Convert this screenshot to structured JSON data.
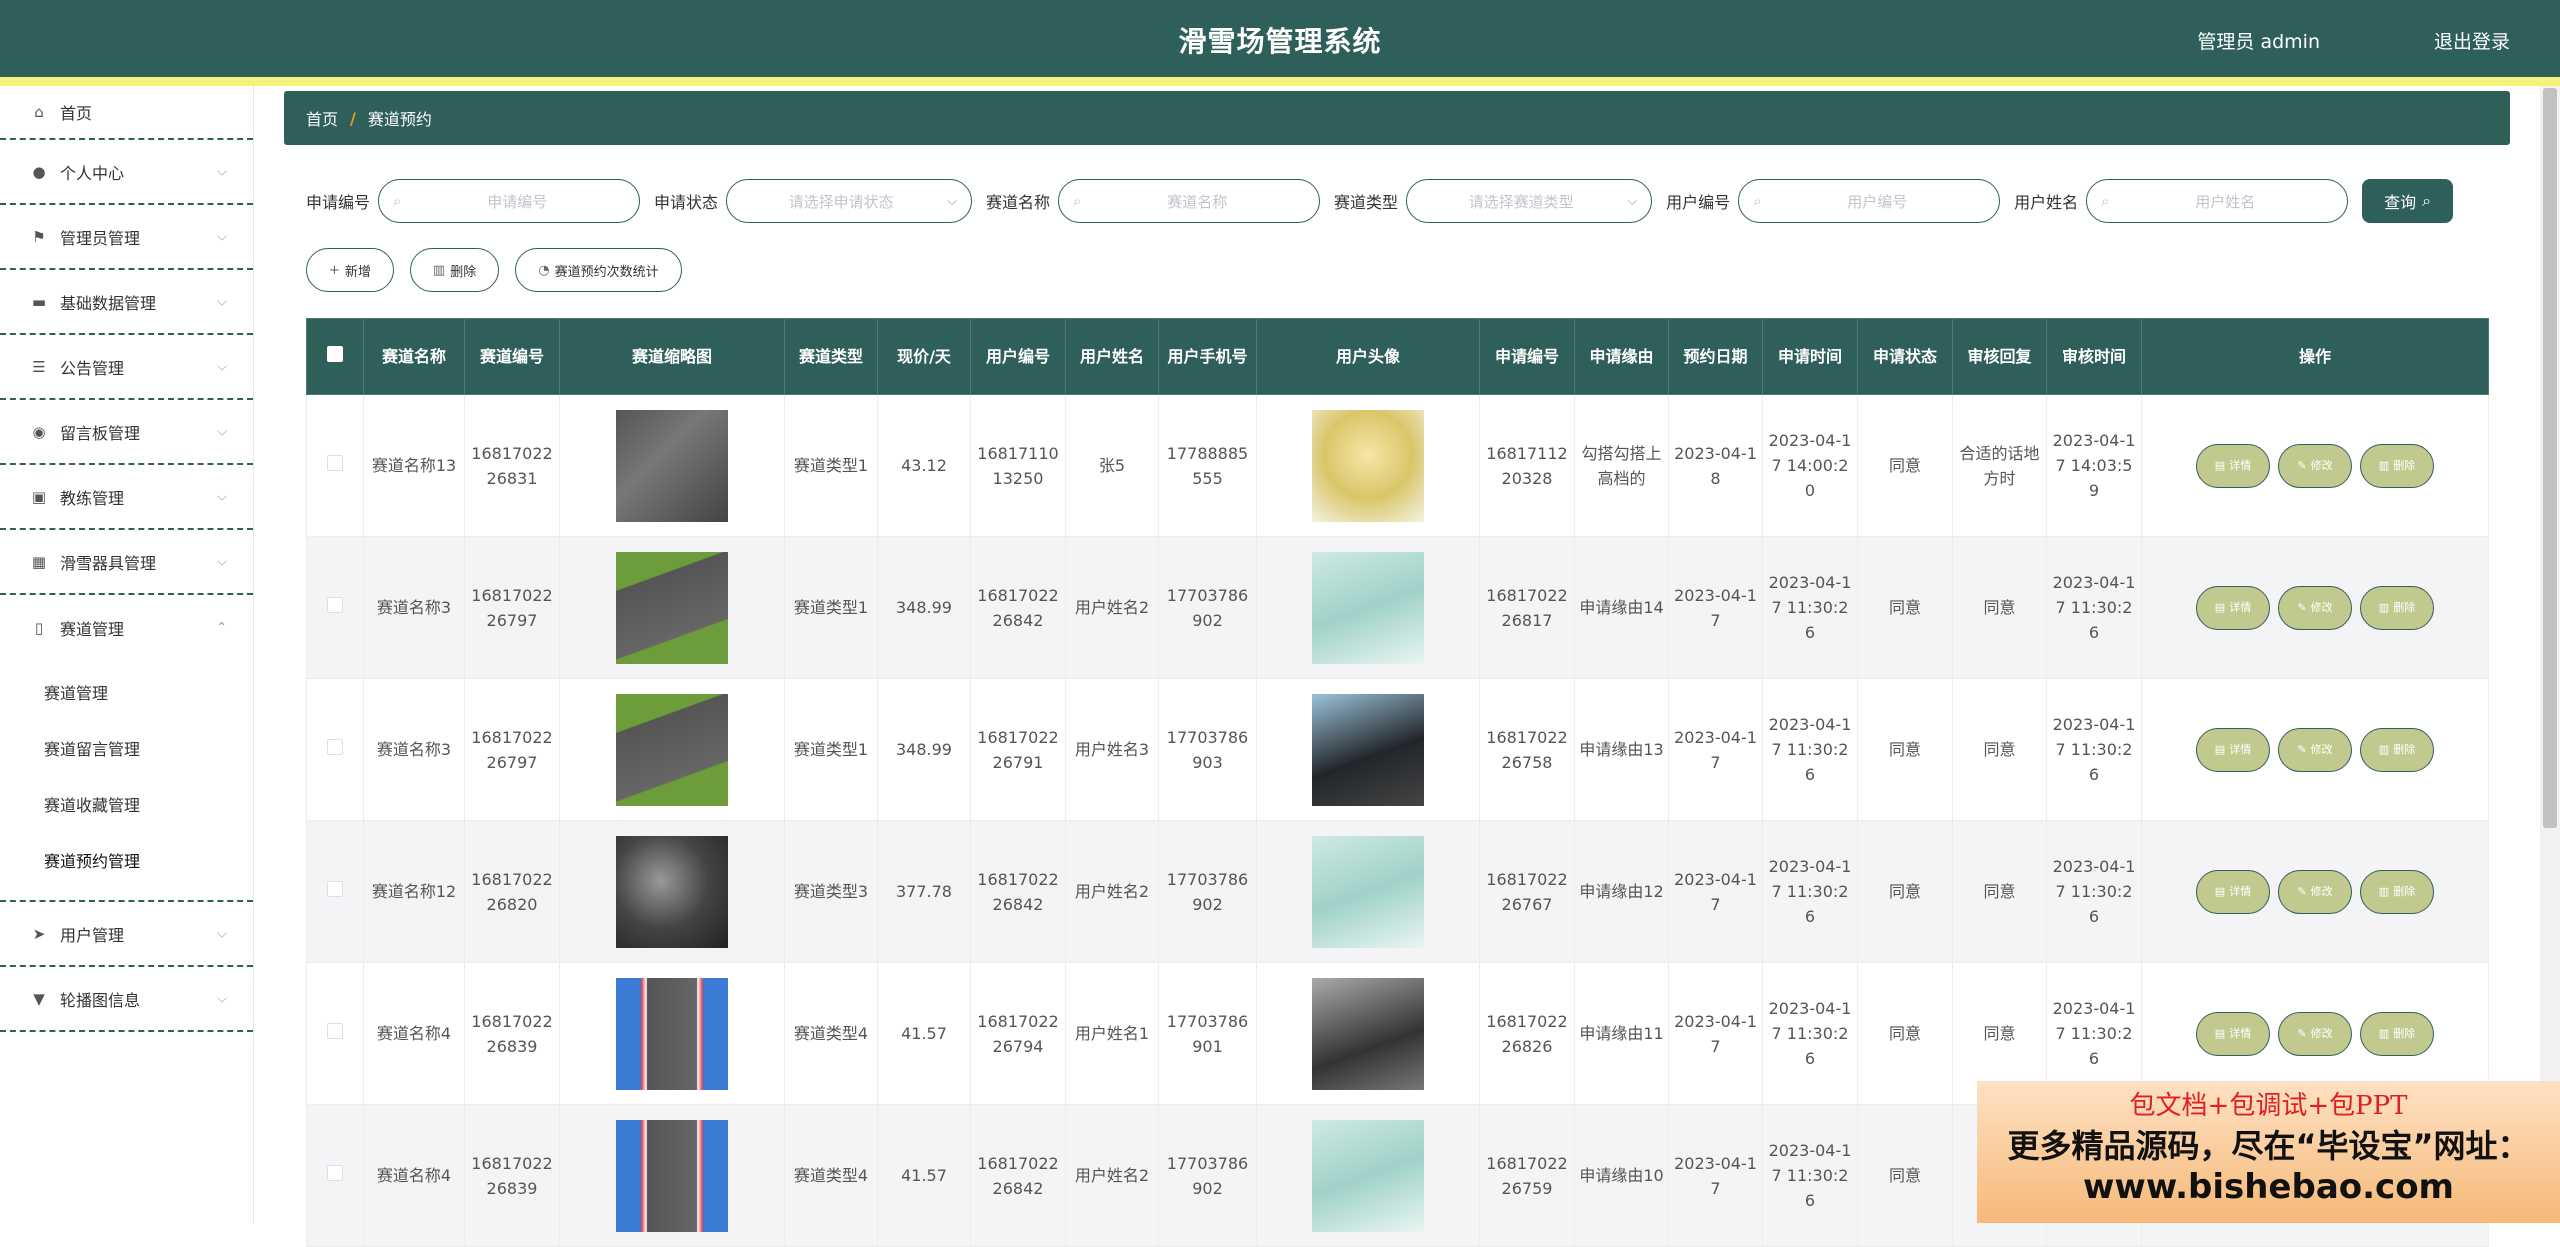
{
  "header": {
    "title": "滑雪场管理系统",
    "user": "管理员 admin",
    "logout": "退出登录"
  },
  "sidebar": {
    "items": [
      {
        "label": "首页",
        "icon": "home-icon"
      },
      {
        "label": "个人中心",
        "icon": "user-icon"
      },
      {
        "label": "管理员管理",
        "icon": "flag-icon"
      },
      {
        "label": "基础数据管理",
        "icon": "monitor-icon"
      },
      {
        "label": "公告管理",
        "icon": "list-icon"
      },
      {
        "label": "留言板管理",
        "icon": "location-icon"
      },
      {
        "label": "教练管理",
        "icon": "briefcase-icon"
      },
      {
        "label": "滑雪器具管理",
        "icon": "grid-icon"
      },
      {
        "label": "赛道管理",
        "icon": "mic-icon"
      },
      {
        "label": "用户管理",
        "icon": "send-icon"
      },
      {
        "label": "轮播图信息",
        "icon": "stamp-icon"
      }
    ],
    "submenu": [
      "赛道管理",
      "赛道留言管理",
      "赛道收藏管理",
      "赛道预约管理"
    ]
  },
  "breadcrumb": {
    "home": "首页",
    "sep": "/",
    "current": "赛道预约"
  },
  "filters": {
    "apply_no_label": "申请编号",
    "apply_no_ph": "申请编号",
    "status_label": "申请状态",
    "status_ph": "请选择申请状态",
    "track_name_label": "赛道名称",
    "track_name_ph": "赛道名称",
    "track_type_label": "赛道类型",
    "track_type_ph": "请选择赛道类型",
    "user_no_label": "用户编号",
    "user_no_ph": "用户编号",
    "user_name_label": "用户姓名",
    "user_name_ph": "用户姓名",
    "query": "查询"
  },
  "actions": {
    "add": "新增",
    "delete": "删除",
    "stats": "赛道预约次数统计"
  },
  "table": {
    "headers": [
      "赛道名称",
      "赛道编号",
      "赛道缩略图",
      "赛道类型",
      "现价/天",
      "用户编号",
      "用户姓名",
      "用户手机号",
      "用户头像",
      "申请编号",
      "申请缘由",
      "预约日期",
      "申请时间",
      "申请状态",
      "审核回复",
      "审核时间",
      "操作"
    ],
    "op_labels": {
      "detail": "详情",
      "edit": "修改",
      "delete": "删除"
    },
    "rows": [
      {
        "name": "赛道名称13",
        "no": "1681702226831",
        "type": "赛道类型1",
        "price": "43.12",
        "user_no": "1681711013250",
        "user_name": "张5",
        "phone": "17788885555",
        "apply_no": "1681711220328",
        "reason": "勾搭勾搭上高档的",
        "date": "2023-04-18",
        "apply_time": "2023-04-17 14:00:20",
        "status": "同意",
        "reply": "合适的话地方时",
        "review_time": "2023-04-17 14:03:59"
      },
      {
        "name": "赛道名称3",
        "no": "1681702226797",
        "type": "赛道类型1",
        "price": "348.99",
        "user_no": "1681702226842",
        "user_name": "用户姓名2",
        "phone": "17703786902",
        "apply_no": "1681702226817",
        "reason": "申请缘由14",
        "date": "2023-04-17",
        "apply_time": "2023-04-17 11:30:26",
        "status": "同意",
        "reply": "同意",
        "review_time": "2023-04-17 11:30:26"
      },
      {
        "name": "赛道名称3",
        "no": "1681702226797",
        "type": "赛道类型1",
        "price": "348.99",
        "user_no": "1681702226791",
        "user_name": "用户姓名3",
        "phone": "17703786903",
        "apply_no": "1681702226758",
        "reason": "申请缘由13",
        "date": "2023-04-17",
        "apply_time": "2023-04-17 11:30:26",
        "status": "同意",
        "reply": "同意",
        "review_time": "2023-04-17 11:30:26"
      },
      {
        "name": "赛道名称12",
        "no": "1681702226820",
        "type": "赛道类型3",
        "price": "377.78",
        "user_no": "1681702226842",
        "user_name": "用户姓名2",
        "phone": "17703786902",
        "apply_no": "1681702226767",
        "reason": "申请缘由12",
        "date": "2023-04-17",
        "apply_time": "2023-04-17 11:30:26",
        "status": "同意",
        "reply": "同意",
        "review_time": "2023-04-17 11:30:26"
      },
      {
        "name": "赛道名称4",
        "no": "1681702226839",
        "type": "赛道类型4",
        "price": "41.57",
        "user_no": "1681702226794",
        "user_name": "用户姓名1",
        "phone": "17703786901",
        "apply_no": "1681702226826",
        "reason": "申请缘由11",
        "date": "2023-04-17",
        "apply_time": "2023-04-17 11:30:26",
        "status": "同意",
        "reply": "同意",
        "review_time": "2023-04-17 11:30:26"
      },
      {
        "name": "赛道名称4",
        "no": "1681702226839",
        "type": "赛道类型4",
        "price": "41.57",
        "user_no": "1681702226842",
        "user_name": "用户姓名2",
        "phone": "17703786902",
        "apply_no": "1681702226759",
        "reason": "申请缘由10",
        "date": "2023-04-17",
        "apply_time": "2023-04-17 11:30:26",
        "status": "同意",
        "reply": "",
        "review_time": ""
      }
    ]
  },
  "ad": {
    "line1": "包文档+包调试+包PPT",
    "line2": "更多精品源码，尽在“毕设宝”网址：",
    "line3": "www.bishebao.com"
  },
  "colors": {
    "primary": "#2f5f5a",
    "accent_yellow": "#f1f37a",
    "op_button": "#c2c98e"
  }
}
